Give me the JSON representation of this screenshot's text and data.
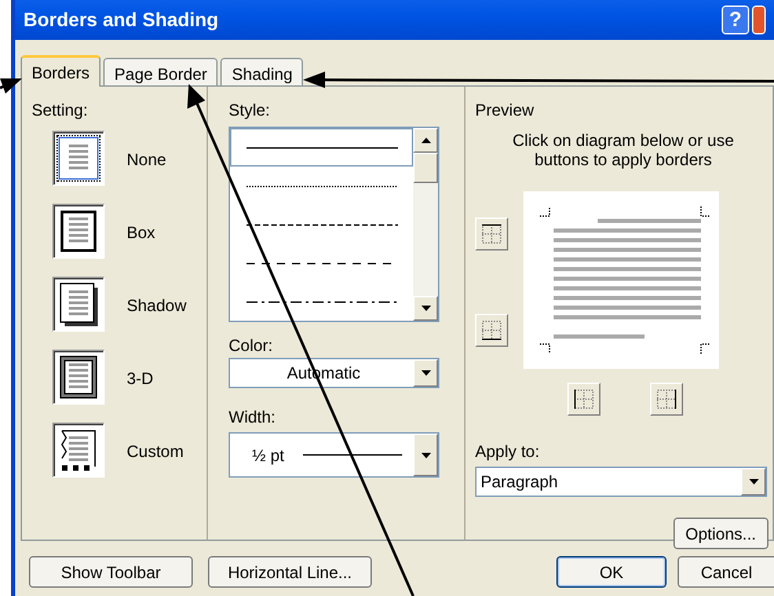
{
  "window": {
    "title": "Borders and Shading",
    "help_button": "?"
  },
  "tabs": [
    {
      "label": "Borders",
      "selected": true
    },
    {
      "label": "Page Border",
      "selected": false
    },
    {
      "label": "Shading",
      "selected": false
    }
  ],
  "setting": {
    "label": "Setting:",
    "options": [
      {
        "label": "None",
        "kind": "none",
        "selected": true
      },
      {
        "label": "Box",
        "kind": "box",
        "selected": false
      },
      {
        "label": "Shadow",
        "kind": "shadow",
        "selected": false
      },
      {
        "label": "3-D",
        "kind": "raised",
        "selected": false
      },
      {
        "label": "Custom",
        "kind": "custom",
        "selected": false
      }
    ]
  },
  "style": {
    "label": "Style:",
    "lines": [
      {
        "kind": "solid",
        "selected": true
      },
      {
        "kind": "dotted",
        "selected": false
      },
      {
        "kind": "dashed",
        "selected": false
      },
      {
        "kind": "long-dashed",
        "selected": false
      },
      {
        "kind": "dash-dot",
        "selected": false
      }
    ]
  },
  "color": {
    "label": "Color:",
    "value": "Automatic"
  },
  "width": {
    "label": "Width:",
    "value": "½ pt"
  },
  "preview": {
    "label": "Preview",
    "hint": "Click on diagram below or use buttons to apply borders"
  },
  "apply_to": {
    "label": "Apply to:",
    "value": "Paragraph"
  },
  "options_button": "Options...",
  "buttons": [
    {
      "label": "Show Toolbar",
      "kind": "left"
    },
    {
      "label": "Horizontal Line...",
      "kind": "left"
    },
    {
      "label": "OK",
      "kind": "right"
    },
    {
      "label": "Cancel",
      "kind": "right"
    }
  ]
}
